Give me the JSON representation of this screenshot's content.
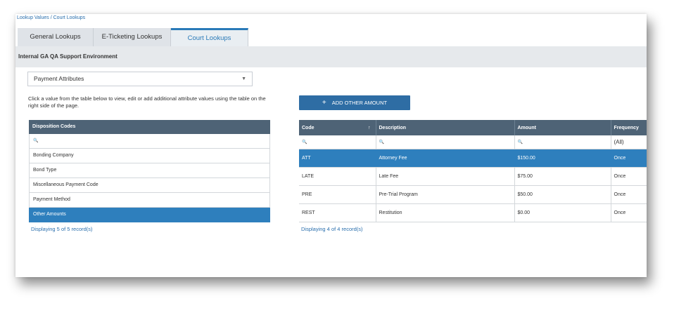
{
  "breadcrumb": "Lookup Values / Court Lookups",
  "tabs": [
    {
      "label": "General Lookups"
    },
    {
      "label": "E-Ticketing Lookups"
    },
    {
      "label": "Court Lookups"
    }
  ],
  "environment": "Internal GA QA Support Environment",
  "dropdown": {
    "selected": "Payment Attributes",
    "caret": "▼"
  },
  "instructions": "Click a value from the table below to view, edit or add additional attribute values using the table on the right side of the page.",
  "add_button": {
    "icon": "+",
    "label": "ADD OTHER AMOUNT"
  },
  "left_table": {
    "header": "Disposition Codes",
    "search_icon": "🔍",
    "rows": [
      "Bonding Company",
      "Bond Type",
      "Miscellaneous Payment Code",
      "Payment Method",
      "Other Amounts"
    ],
    "selected_index": 4,
    "footer": "Displaying 5 of 5 record(s)"
  },
  "right_table": {
    "columns": [
      "Code",
      "Description",
      "Amount",
      "Frequency"
    ],
    "sort_icon": "↑",
    "search_icon": "🔍",
    "frequency_filter": "(All)",
    "rows": [
      {
        "code": "ATT",
        "description": "Attorney Fee",
        "amount": "$150.00",
        "frequency": "Once"
      },
      {
        "code": "LATE",
        "description": "Late Fee",
        "amount": "$75.00",
        "frequency": "Once"
      },
      {
        "code": "PRE",
        "description": "Pre-Trial Program",
        "amount": "$50.00",
        "frequency": "Once"
      },
      {
        "code": "REST",
        "description": "Restitution",
        "amount": "$0.00",
        "frequency": "Once"
      }
    ],
    "footer": "Displaying 4 of 4 record(s)"
  }
}
